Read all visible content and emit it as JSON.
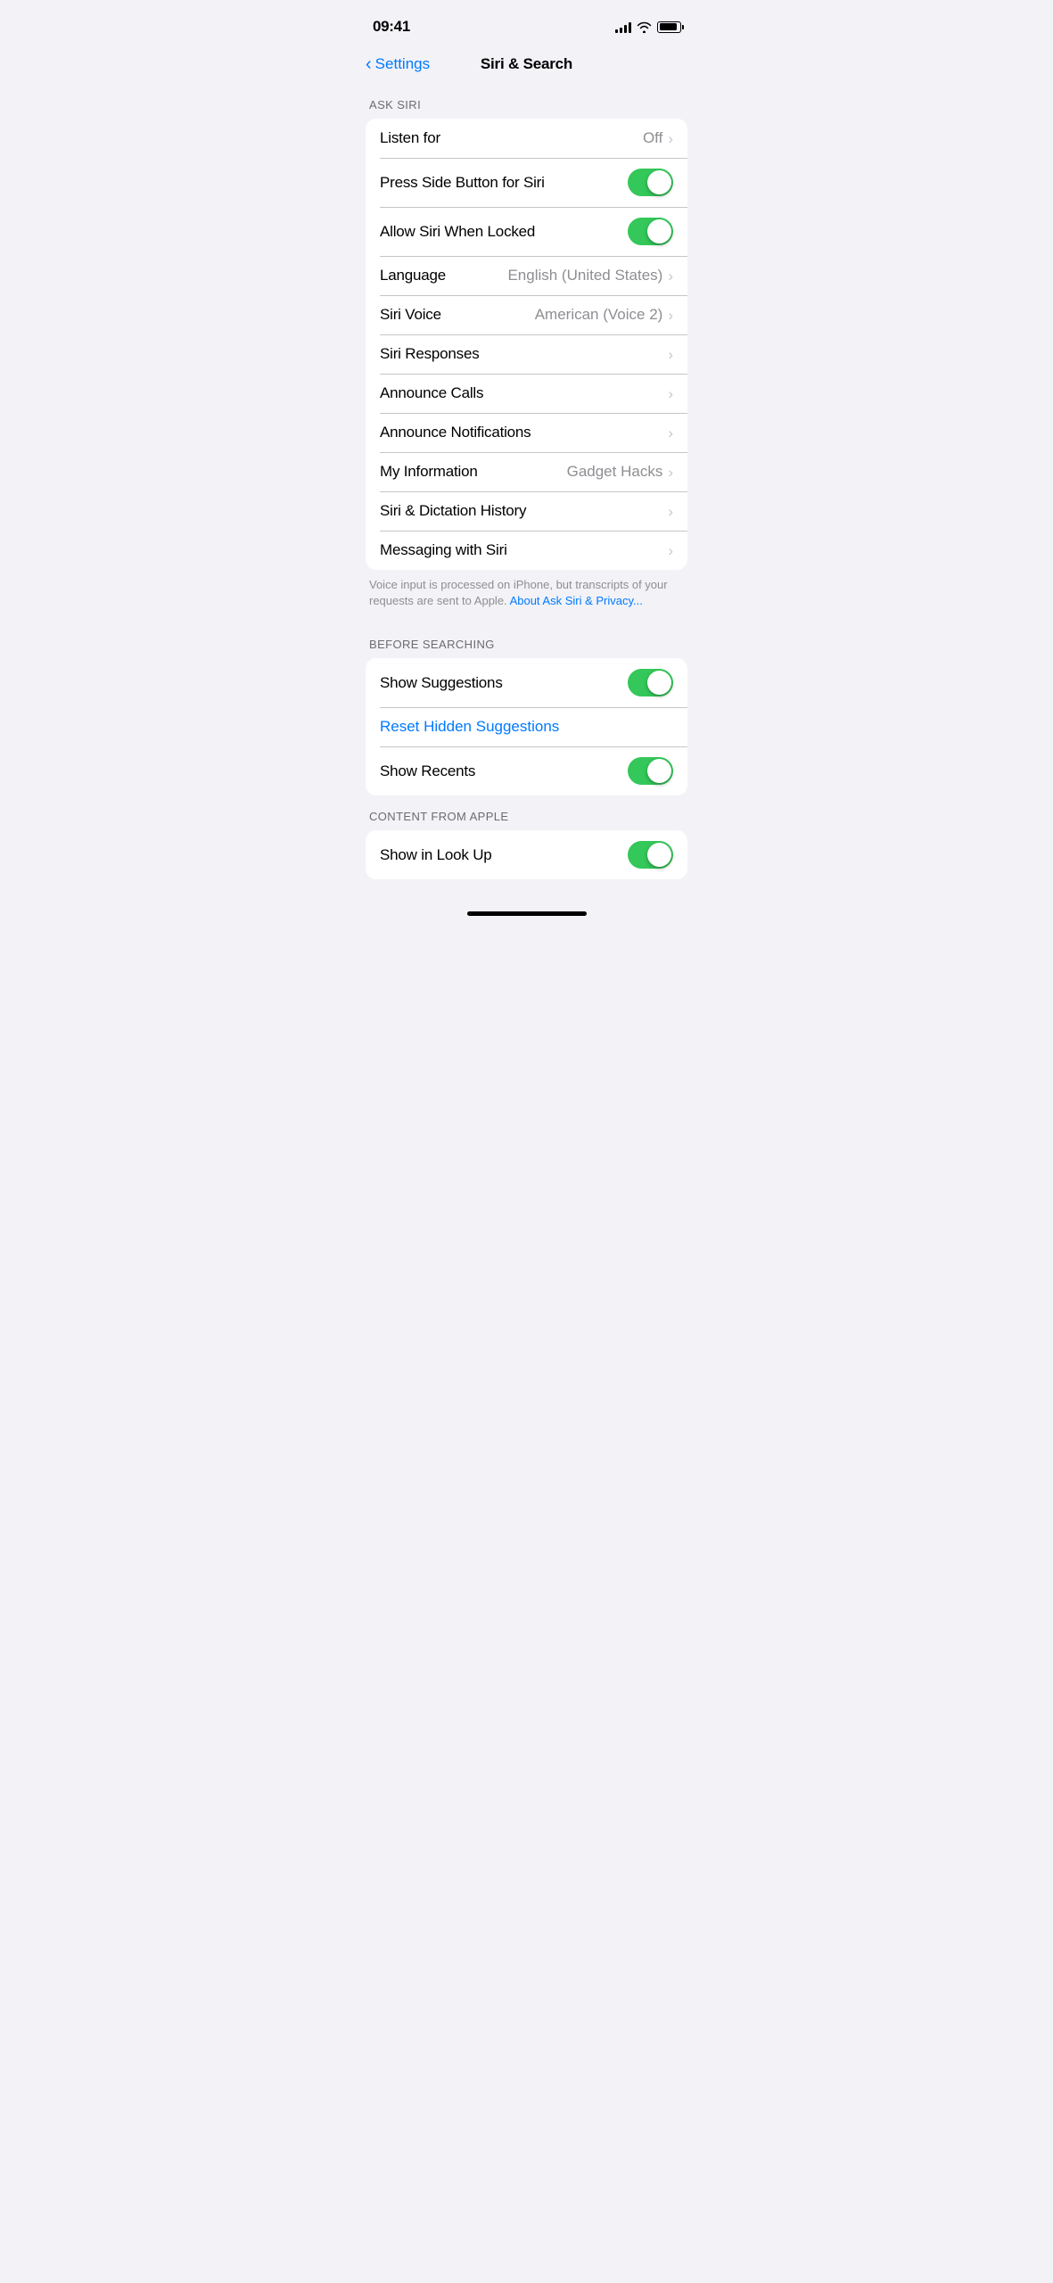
{
  "statusBar": {
    "time": "09:41",
    "signalBars": [
      4,
      6,
      8,
      10,
      12
    ],
    "batteryLevel": 90
  },
  "navigation": {
    "backLabel": "Settings",
    "title": "Siri & Search"
  },
  "sections": {
    "askSiri": {
      "label": "ASK SIRI",
      "rows": [
        {
          "id": "listen-for",
          "label": "Listen for",
          "value": "Off",
          "type": "chevron",
          "hasChevron": true
        },
        {
          "id": "press-side-button",
          "label": "Press Side Button for Siri",
          "value": null,
          "type": "toggle",
          "enabled": true
        },
        {
          "id": "allow-when-locked",
          "label": "Allow Siri When Locked",
          "value": null,
          "type": "toggle",
          "enabled": true
        },
        {
          "id": "language",
          "label": "Language",
          "value": "English (United States)",
          "type": "chevron",
          "hasChevron": true
        },
        {
          "id": "siri-voice",
          "label": "Siri Voice",
          "value": "American (Voice 2)",
          "type": "chevron",
          "hasChevron": true
        },
        {
          "id": "siri-responses",
          "label": "Siri Responses",
          "value": null,
          "type": "chevron",
          "hasChevron": true
        },
        {
          "id": "announce-calls",
          "label": "Announce Calls",
          "value": null,
          "type": "chevron",
          "hasChevron": true
        },
        {
          "id": "announce-notifications",
          "label": "Announce Notifications",
          "value": null,
          "type": "chevron",
          "hasChevron": true
        },
        {
          "id": "my-information",
          "label": "My Information",
          "value": "Gadget Hacks",
          "type": "chevron",
          "hasChevron": true
        },
        {
          "id": "siri-dictation-history",
          "label": "Siri & Dictation History",
          "value": null,
          "type": "chevron",
          "hasChevron": true
        },
        {
          "id": "messaging-with-siri",
          "label": "Messaging with Siri",
          "value": null,
          "type": "chevron",
          "hasChevron": true
        }
      ],
      "footerText": "Voice input is processed on iPhone, but transcripts of your requests are sent to Apple. ",
      "footerLinkText": "About Ask Siri & Privacy...",
      "footerLinkUrl": "#"
    },
    "beforeSearching": {
      "label": "BEFORE SEARCHING",
      "rows": [
        {
          "id": "show-suggestions",
          "label": "Show Suggestions",
          "value": null,
          "type": "toggle",
          "enabled": true
        },
        {
          "id": "reset-hidden-suggestions",
          "label": "Reset Hidden Suggestions",
          "value": null,
          "type": "link"
        },
        {
          "id": "show-recents",
          "label": "Show Recents",
          "value": null,
          "type": "toggle",
          "enabled": true
        }
      ]
    },
    "contentFromApple": {
      "label": "CONTENT FROM APPLE",
      "rows": [
        {
          "id": "show-in-look-up",
          "label": "Show in Look Up",
          "value": null,
          "type": "toggle",
          "enabled": true
        }
      ]
    }
  },
  "homeIndicator": true
}
